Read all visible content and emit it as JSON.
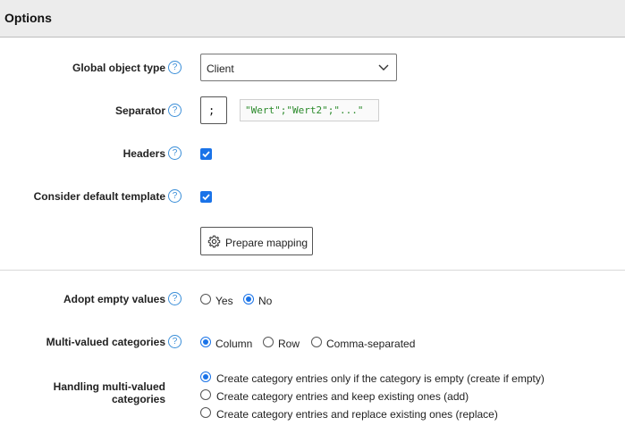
{
  "header": {
    "title": "Options"
  },
  "fields": {
    "global_object_type": {
      "label": "Global object type",
      "value": "Client"
    },
    "separator": {
      "label": "Separator",
      "value": ";",
      "sample": "\"Wert\";\"Wert2\";\"...\""
    },
    "headers": {
      "label": "Headers",
      "checked": true
    },
    "consider_default_template": {
      "label": "Consider default template",
      "checked": true
    },
    "prepare_mapping": {
      "label": "Prepare mapping"
    },
    "adopt_empty_values": {
      "label": "Adopt empty values",
      "options": [
        "Yes",
        "No"
      ],
      "selected": "No"
    },
    "multi_valued_categories": {
      "label": "Multi-valued categories",
      "options": [
        "Column",
        "Row",
        "Comma-separated"
      ],
      "selected": "Column"
    },
    "handling_multi_valued": {
      "label_line1": "Handling multi-valued",
      "label_line2": "categories",
      "options": [
        "Create category entries only if the category is empty (create if empty)",
        "Create category entries and keep existing ones (add)",
        "Create category entries and replace existing ones (replace)"
      ],
      "selected": "Create category entries only if the category is empty (create if empty)"
    }
  },
  "help_symbol": "?",
  "colors": {
    "accent": "#1a73e8",
    "help": "#3a8ed8",
    "sample_text": "#2b8a2b",
    "header_bg": "#ececec"
  }
}
